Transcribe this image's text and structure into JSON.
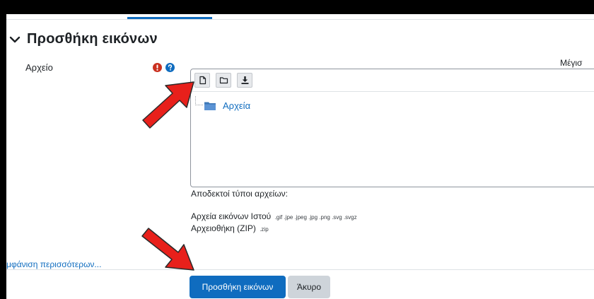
{
  "section": {
    "title": "Προσθήκη εικόνων"
  },
  "field": {
    "label": "Αρχείο",
    "max_size_label": "Μέγισ"
  },
  "filepicker": {
    "buttons": [
      {
        "icon": "file-add-icon"
      },
      {
        "icon": "folder-create-icon"
      },
      {
        "icon": "download-icon"
      }
    ],
    "folder": {
      "name": "Αρχεία",
      "icon": "folder-icon"
    }
  },
  "accepted": {
    "heading": "Αποδεκτοί τύποι αρχείων:",
    "types": [
      {
        "name": "Αρχεία εικόνων Ιστού",
        "extensions": ".gif .jpe .jpeg .jpg .png .svg .svgz"
      },
      {
        "name": "Αρχειοθήκη (ZIP)",
        "extensions": ".zip"
      }
    ]
  },
  "show_more_link": "μφάνιση περισσότερων...",
  "actions": {
    "submit": "Προσθήκη εικόνων",
    "cancel": "Άκυρο"
  },
  "colors": {
    "primary": "#0f6cbf",
    "required": "#ca3120",
    "arrow": "#e8201b"
  }
}
